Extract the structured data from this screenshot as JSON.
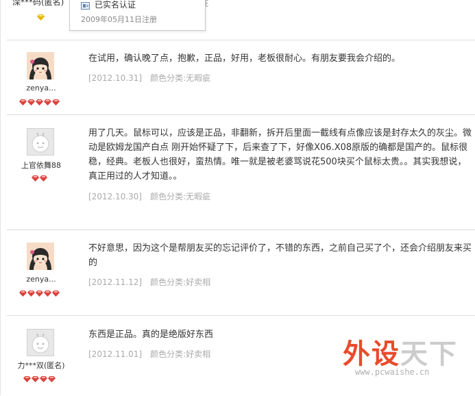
{
  "top": {
    "username": "滦***码(匿名)",
    "stub_text": "疵",
    "popup": {
      "title": "已实名认证",
      "date": "2009年05月11日注册"
    }
  },
  "reviews": [
    {
      "user": "zenya...",
      "avatar": "cartoon-girl-avatar",
      "rep_count": 5,
      "content": "在试用，确认晚了点，抱歉，正品，好用，老板很耐心。有朋友要我会介绍的。",
      "date": "[2012.10.31]",
      "sku": "颜色分类:无暇疵"
    },
    {
      "user": "上官依舞88",
      "avatar": "default-avatar",
      "rep_count": 2,
      "content": "用了几天。鼠标可以，应该是正品，非翻新，拆开后里面一截线有点像应该是封存太久的灰尘。微动是欧姆龙国产白点 刚开始怀疑了下，后来查了下，好像X06.X08原版的确都是国产的。鼠标很稳，经典。老板人也很好，蛮热情。唯一就是被老婆骂说花500块买个鼠标太贵。。其实我想说，真正用过的人才知道。。",
      "date": "[2012.10.30]",
      "sku": "颜色分类:无暇疵"
    },
    {
      "user": "zenya...",
      "avatar": "cartoon-girl-avatar",
      "rep_count": 5,
      "content": "不好意思，因为这个是帮朋友买的忘记评价了，不错的东西，之前自己买了个，还会介绍朋友来买的",
      "date": "[2012.11.12]",
      "sku": "颜色分类:好卖相"
    },
    {
      "user": "力***双(匿名)",
      "avatar": "default-avatar",
      "rep_count": 4,
      "content": "东西是正品。真的是绝版好东西",
      "date": "[2012.11.01]",
      "sku": "颜色分类:好卖相"
    }
  ],
  "watermark": {
    "part1": "外设",
    "part2": "天下",
    "url": "www.pcwaishe.cn",
    "accent": "#e84b2c"
  }
}
